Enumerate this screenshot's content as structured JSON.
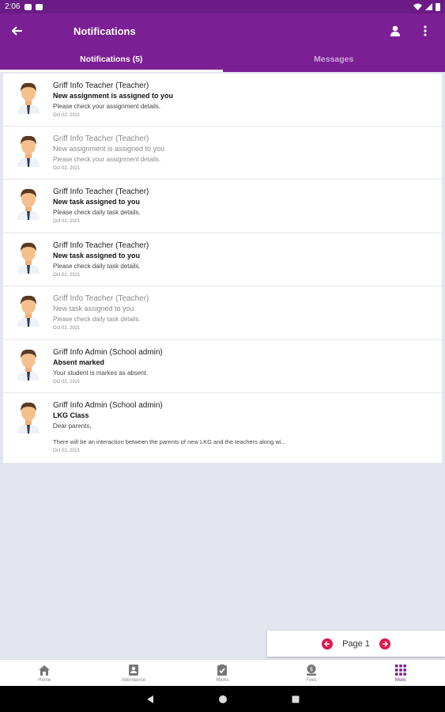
{
  "status_bar": {
    "time": "2:06"
  },
  "app_bar": {
    "title": "Notifications"
  },
  "tabs": [
    {
      "label": "Notifications (5)",
      "active": true
    },
    {
      "label": "Messages",
      "active": false
    }
  ],
  "notifications": [
    {
      "sender": "Griff Info Teacher (Teacher)",
      "subject": "New assignment is assigned to you",
      "body": "Please check your assignment details.",
      "date": "Oct 02, 2021",
      "read": false
    },
    {
      "sender": "Griff Info Teacher (Teacher)",
      "subject": "New assignment is assigned to you",
      "body": "Please check your assignment details.",
      "date": "Oct 02, 2021",
      "read": true
    },
    {
      "sender": "Griff Info Teacher (Teacher)",
      "subject": "New task assigned to you",
      "body": "Please check daily task details.",
      "date": "Oct 02, 2021",
      "read": false
    },
    {
      "sender": "Griff Info Teacher (Teacher)",
      "subject": "New task assigned to you",
      "body": "Please check daily task details.",
      "date": "Oct 02, 2021",
      "read": false
    },
    {
      "sender": "Griff Info Teacher (Teacher)",
      "subject": "New task assigned to you",
      "body": "Please check daily task details.",
      "date": "Oct 02, 2021",
      "read": true
    },
    {
      "sender": "Griff Info Admin (School admin)",
      "subject": "Absent marked",
      "body": "Your student is markes as absent.",
      "date": "Oct 02, 2021",
      "read": false
    },
    {
      "sender": "Griff Info Admin (School admin)",
      "subject": "LKG Class",
      "body": "Dear parents,",
      "body2": "There will be an interaction between the parents of new LKG and the teachers along wi...",
      "date": "Oct 02, 2021",
      "read": false
    }
  ],
  "pager": {
    "label": "Page 1"
  },
  "bottom_nav": [
    {
      "label": "Home",
      "icon": "home-icon",
      "active": false
    },
    {
      "label": "Attendance",
      "icon": "attendance-icon",
      "active": false
    },
    {
      "label": "Marks",
      "icon": "marks-icon",
      "active": false
    },
    {
      "label": "Fees",
      "icon": "fees-icon",
      "active": false
    },
    {
      "label": "More",
      "icon": "grid-icon",
      "active": true
    }
  ],
  "colors": {
    "primary": "#7b1f94",
    "status_bar": "#6a1b86",
    "accent": "#e0174d",
    "background": "#e3e6ec"
  }
}
